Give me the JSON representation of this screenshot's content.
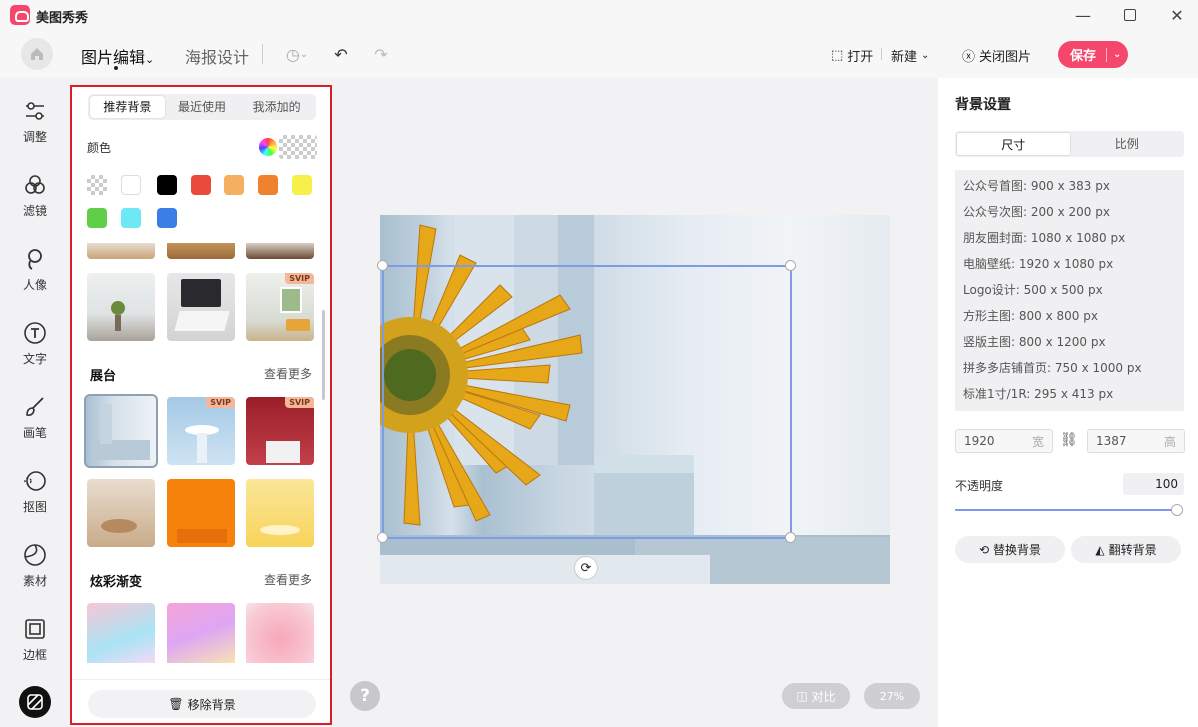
{
  "app": {
    "title": "美图秀秀"
  },
  "toolbar": {
    "tab_edit": "图片编辑",
    "tab_poster": "海报设计",
    "open_label": "打开",
    "new_label": "新建",
    "close_image_label": "关闭图片",
    "save_label": "保存"
  },
  "rail": {
    "items": [
      {
        "label": "调整",
        "icon": "sliders-icon"
      },
      {
        "label": "滤镜",
        "icon": "filter-icon"
      },
      {
        "label": "人像",
        "icon": "portrait-icon"
      },
      {
        "label": "文字",
        "icon": "text-icon"
      },
      {
        "label": "画笔",
        "icon": "brush-icon"
      },
      {
        "label": "抠图",
        "icon": "cutout-icon"
      },
      {
        "label": "素材",
        "icon": "sticker-icon"
      },
      {
        "label": "边框",
        "icon": "frame-icon"
      }
    ]
  },
  "bg_panel": {
    "tabs": [
      "推荐背景",
      "最近使用",
      "我添加的"
    ],
    "active_tab": 0,
    "color_label": "颜色",
    "colors": [
      "transparent",
      "#ffffff",
      "#000000",
      "#e94a3a",
      "#f4b05e",
      "#f0812f",
      "#f7f04a",
      "#5fcf4a",
      "#6ee8f4",
      "#3b7ee8"
    ],
    "svip_badge": "SVIP",
    "section_stage": "展台",
    "section_gradient": "炫彩渐变",
    "see_more": "查看更多",
    "remove_bg": "移除背景"
  },
  "canvas": {
    "compare_label": "对比",
    "zoom_label": "27%",
    "help_label": "?"
  },
  "right_panel": {
    "title": "背景设置",
    "tabs": [
      "尺寸",
      "比例"
    ],
    "presets": [
      "公众号首图: 900 x 383 px",
      "公众号次图: 200 x 200 px",
      "朋友圈封面: 1080 x 1080 px",
      "电脑壁纸: 1920 x 1080 px",
      "Logo设计: 500 x 500 px",
      "方形主图: 800 x 800 px",
      "竖版主图: 800 x 1200 px",
      "拼多多店铺首页: 750 x 1000 px",
      "标准1寸/1R: 295 x 413 px"
    ],
    "width_value": "1920",
    "width_unit": "宽",
    "height_value": "1387",
    "height_unit": "高",
    "opacity_label": "不透明度",
    "opacity_value": "100",
    "replace_bg": "替换背景",
    "flip_bg": "翻转背景"
  }
}
